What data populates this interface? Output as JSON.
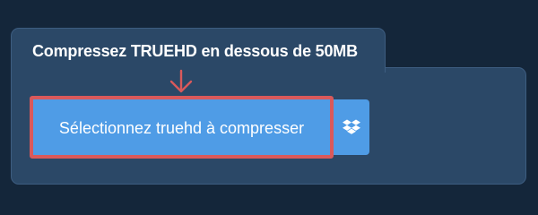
{
  "tab": {
    "title": "Compressez TRUEHD en dessous de 50MB"
  },
  "upload": {
    "select_label": "Sélectionnez truehd à compresser",
    "dropbox_icon": "dropbox-icon",
    "pointer_icon": "arrow-down-icon"
  },
  "colors": {
    "page_background": "#14263a",
    "panel_background": "#2b4867",
    "button_blue": "#4f9ce6",
    "highlight_red": "#d9595b"
  }
}
